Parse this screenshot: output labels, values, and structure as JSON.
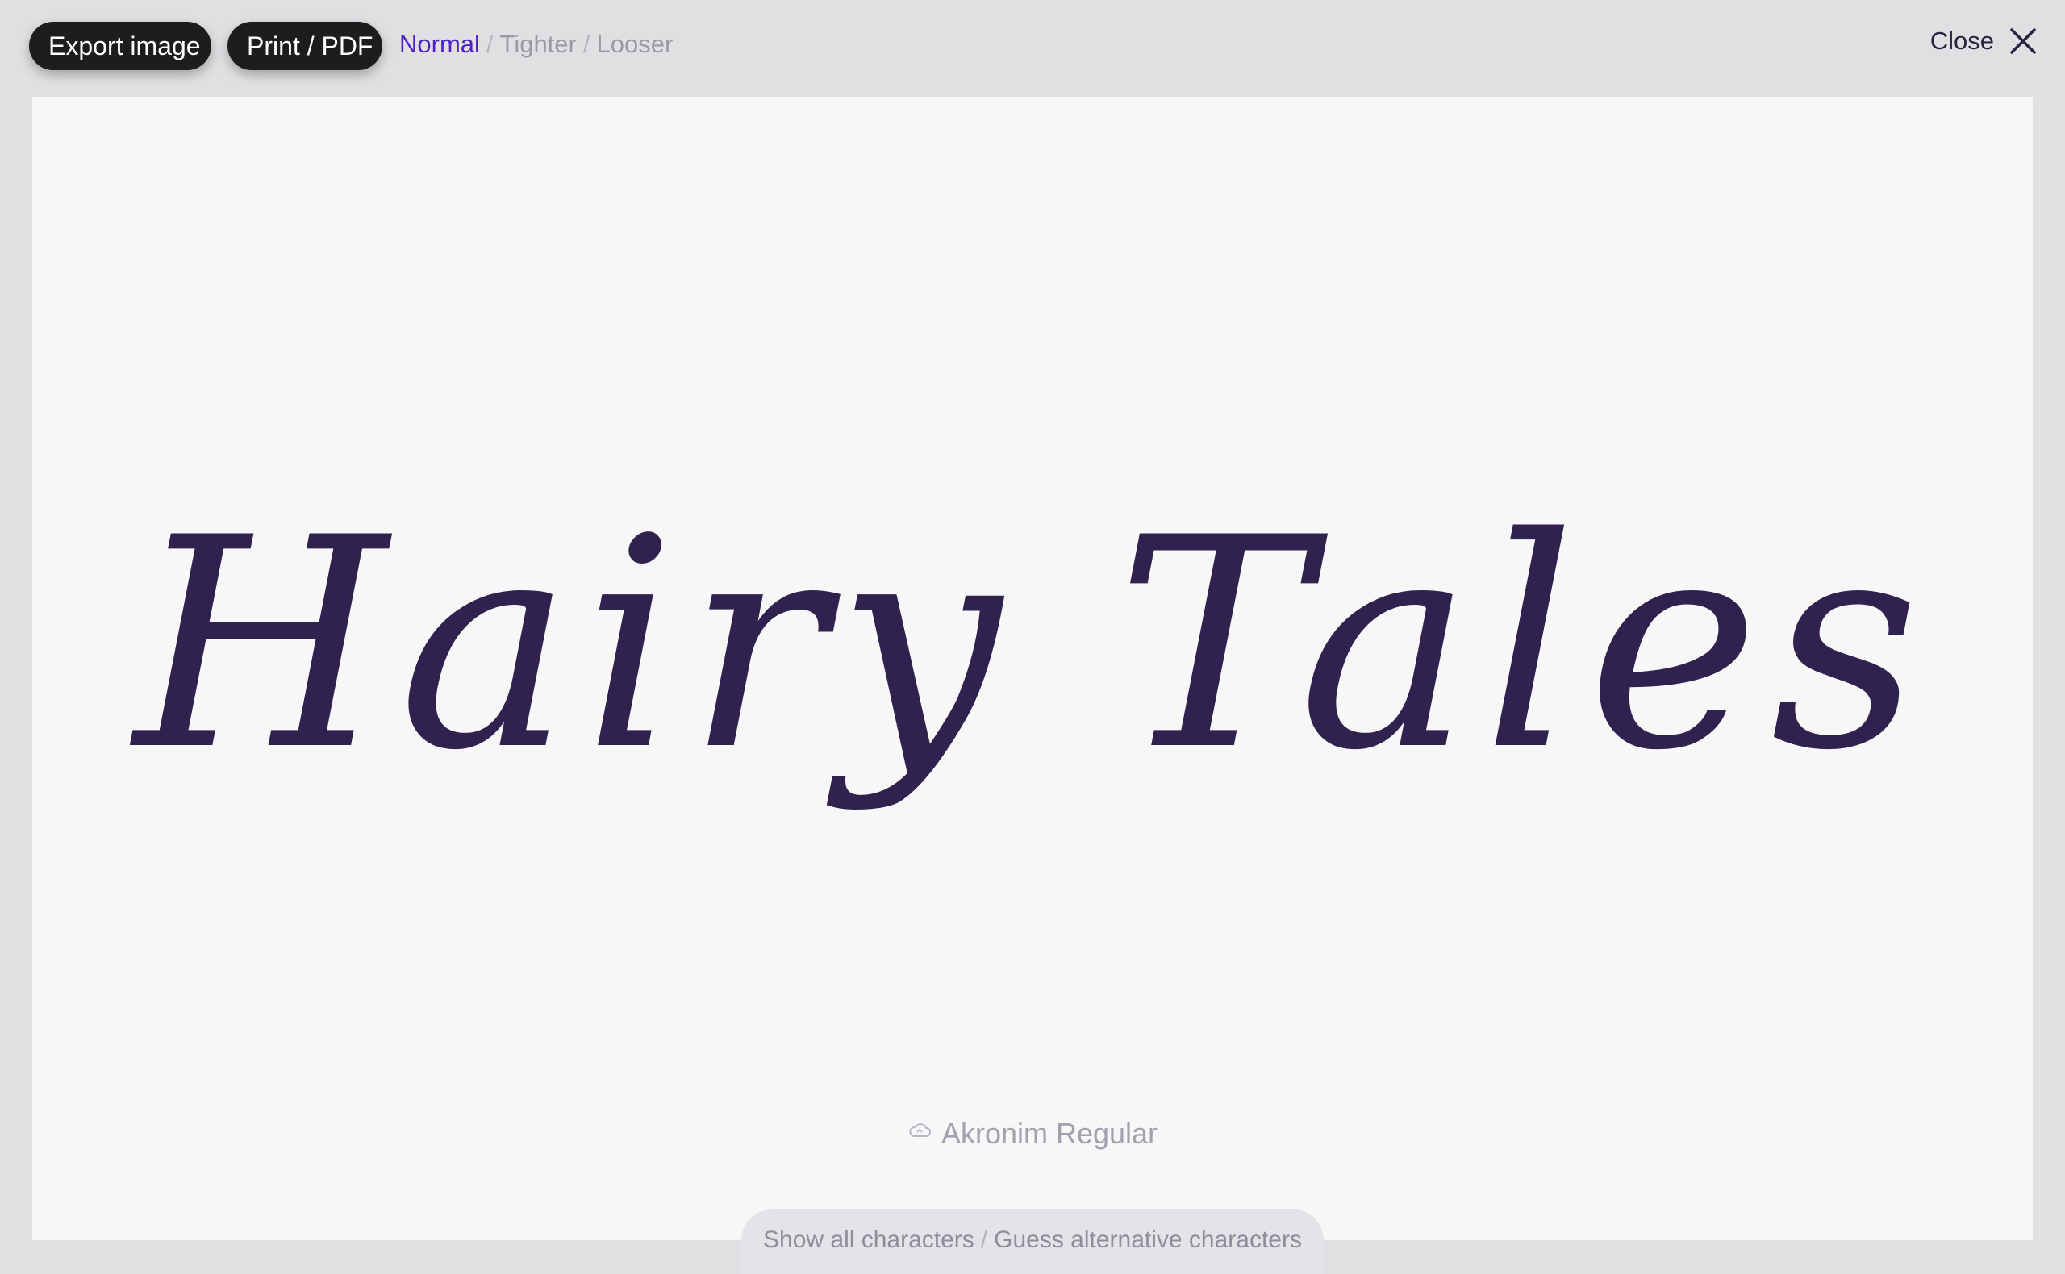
{
  "toolbar": {
    "export_label": "Export image",
    "print_label": "Print / PDF",
    "spacing": {
      "options": [
        "Normal",
        "Tighter",
        "Looser"
      ],
      "separator": "/",
      "selected": "Normal"
    },
    "close_label": "Close"
  },
  "preview": {
    "text": "Hairy Tales",
    "color": "#30224f"
  },
  "font": {
    "name": "Akronim Regular",
    "icon": "cloud-icon"
  },
  "bottom": {
    "show_all_label": "Show all characters",
    "separator": "/",
    "guess_label": "Guess alternative characters"
  },
  "colors": {
    "accent": "#4f22c8",
    "button_bg": "#1d1d1f",
    "canvas_bg": "#f7f7f8",
    "page_bg": "#e0e0e3"
  }
}
